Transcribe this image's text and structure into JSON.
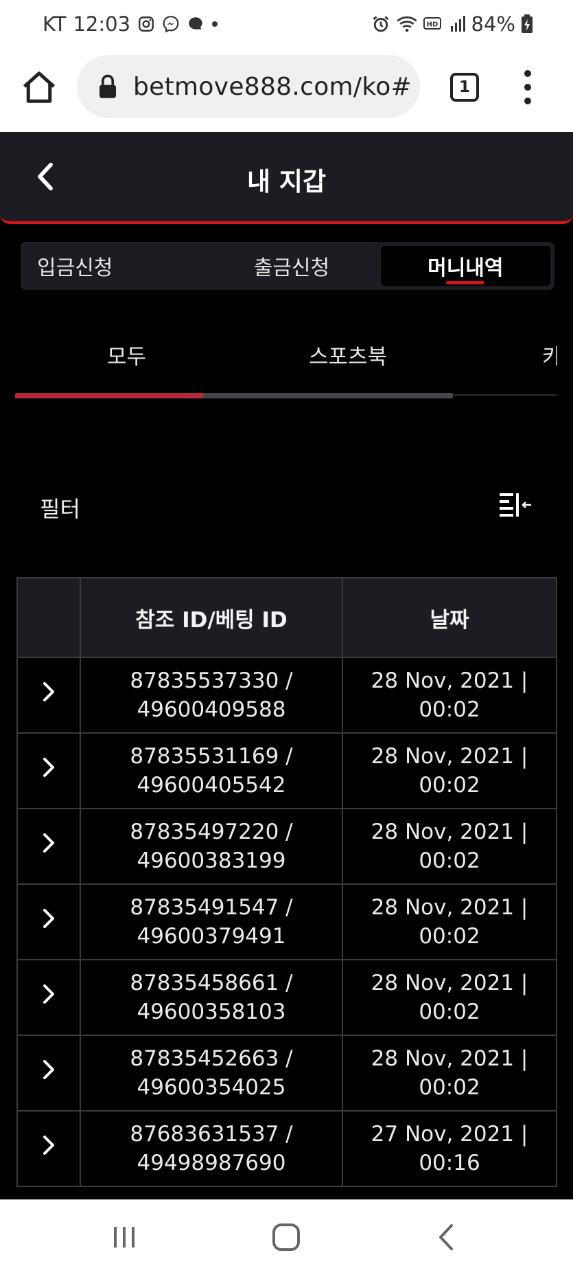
{
  "status_bar": {
    "carrier": "KT",
    "time": "12:03",
    "battery": "84%"
  },
  "browser": {
    "url": "betmove888.com/ko#",
    "tab_count": "1"
  },
  "header": {
    "title": "내 지갑"
  },
  "segment_tabs": [
    {
      "label": "입금신청"
    },
    {
      "label": "출금신청"
    },
    {
      "label": "머니내역"
    }
  ],
  "category_tabs": [
    {
      "label": "모두"
    },
    {
      "label": "스포츠북"
    },
    {
      "label": "카"
    }
  ],
  "category_scroll": {
    "progress": 0.43
  },
  "filter": {
    "label": "필터"
  },
  "table": {
    "headers": [
      "참조 ID/베팅 ID",
      "날짜"
    ],
    "rows": [
      {
        "ref": "87835537330 /",
        "bet": "49600409588",
        "date": "28 Nov, 2021 |",
        "time": "00:02"
      },
      {
        "ref": "87835531169 /",
        "bet": "49600405542",
        "date": "28 Nov, 2021 |",
        "time": "00:02"
      },
      {
        "ref": "87835497220 /",
        "bet": "49600383199",
        "date": "28 Nov, 2021 |",
        "time": "00:02"
      },
      {
        "ref": "87835491547 /",
        "bet": "49600379491",
        "date": "28 Nov, 2021 |",
        "time": "00:02"
      },
      {
        "ref": "87835458661 /",
        "bet": "49600358103",
        "date": "28 Nov, 2021 |",
        "time": "00:02"
      },
      {
        "ref": "87835452663 /",
        "bet": "49600354025",
        "date": "28 Nov, 2021 |",
        "time": "00:02"
      },
      {
        "ref": "87683631537 /",
        "bet": "49498987690",
        "date": "27 Nov, 2021 |",
        "time": "00:16"
      }
    ]
  },
  "colors": {
    "accent": "#d6161b",
    "scroll_fill": "#b6283a",
    "panel": "#1c1d22",
    "background": "#000000"
  }
}
